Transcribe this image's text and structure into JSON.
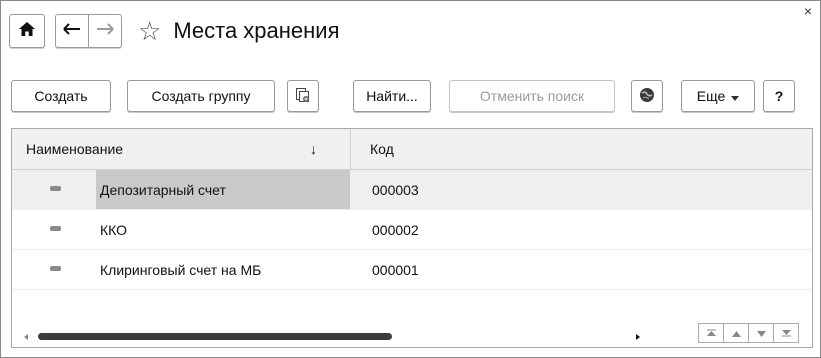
{
  "window": {
    "title": "Места хранения",
    "close": "×"
  },
  "toolbar": {
    "create": "Создать",
    "create_group": "Создать группу",
    "find": "Найти...",
    "cancel_search": "Отменить поиск",
    "more": "Еще",
    "help": "?"
  },
  "table": {
    "columns": [
      "Наименование",
      "Код"
    ],
    "sort_indicator": "↓",
    "rows": [
      {
        "name": "Депозитарный счет",
        "code": "000003",
        "selected": true
      },
      {
        "name": "ККО",
        "code": "000002",
        "selected": false
      },
      {
        "name": "Клиринговый счет на МБ",
        "code": "000001",
        "selected": false
      }
    ]
  },
  "icons": [
    "home-icon",
    "back-arrow-icon",
    "forward-arrow-icon",
    "star-icon",
    "copy-icon",
    "globe-icon",
    "dropdown-icon",
    "scroll-top-icon",
    "scroll-up-icon",
    "scroll-down-icon",
    "scroll-bottom-icon"
  ]
}
